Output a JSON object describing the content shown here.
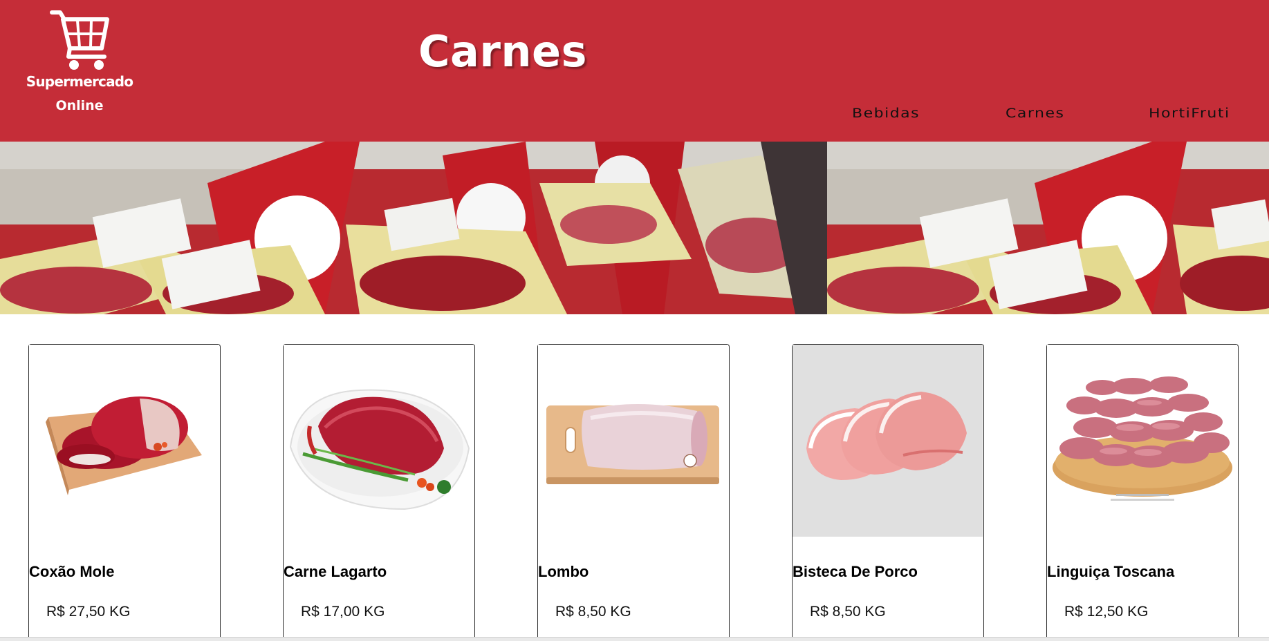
{
  "brand": {
    "line1": "Supermercado",
    "line2": "Online",
    "logo_icon": "shopping-cart-icon"
  },
  "header": {
    "title": "Carnes",
    "background_color": "#c52d38"
  },
  "nav": {
    "items": [
      {
        "label": "Bebidas"
      },
      {
        "label": "Carnes"
      },
      {
        "label": "HortiFruti"
      }
    ]
  },
  "banner": {
    "image": "meat-display-banner"
  },
  "products": [
    {
      "name": "Coxão Mole",
      "price": "R$ 27,50 KG"
    },
    {
      "name": "Carne Lagarto",
      "price": "R$ 17,00 KG"
    },
    {
      "name": "Lombo",
      "price": "R$ 8,50 KG"
    },
    {
      "name": "Bisteca De Porco",
      "price": "R$ 8,50 KG"
    },
    {
      "name": "Linguiça Toscana",
      "price": "R$ 12,50 KG"
    }
  ]
}
